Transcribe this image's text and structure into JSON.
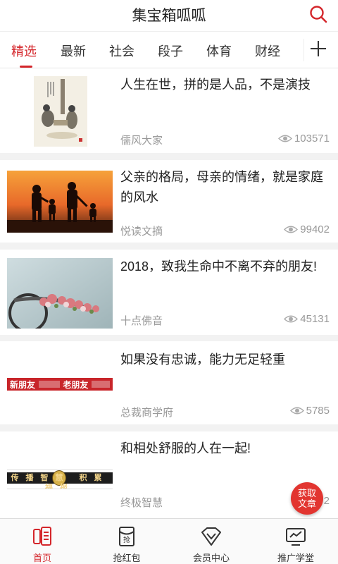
{
  "header": {
    "title": "集宝箱呱呱"
  },
  "tabs": [
    {
      "label": "精选"
    },
    {
      "label": "最新"
    },
    {
      "label": "社会"
    },
    {
      "label": "段子"
    },
    {
      "label": "体育"
    },
    {
      "label": "财经"
    }
  ],
  "articles": [
    {
      "title": "人生在世，拼的是人品，不是演技",
      "source": "儒风大家",
      "views": "103571"
    },
    {
      "title": "父亲的格局，母亲的情绪，就是家庭的风水",
      "source": "悦读文摘",
      "views": "99402"
    },
    {
      "title": "2018，致我生命中不离不弃的朋友!",
      "source": "十点佛音",
      "views": "45131"
    },
    {
      "title": "如果没有忠诚，能力无足轻重",
      "source": "总裁商学府",
      "views": "5785",
      "thumb_text_left": "新朋友",
      "thumb_text_right": "老朋友"
    },
    {
      "title": "和相处舒服的人在一起!",
      "source": "终极智慧",
      "views": "2",
      "thumb_text": "传播智慧 积累福报"
    }
  ],
  "fab": {
    "line1": "获取",
    "line2": "文章"
  },
  "tabbar": [
    {
      "label": "首页",
      "icon": "home-icon"
    },
    {
      "label": "抢红包",
      "icon": "red-envelope-icon"
    },
    {
      "label": "会员中心",
      "icon": "vip-icon"
    },
    {
      "label": "推广学堂",
      "icon": "monitor-icon"
    }
  ],
  "colors": {
    "accent": "#d4262b",
    "background": "#f2f2f2"
  }
}
